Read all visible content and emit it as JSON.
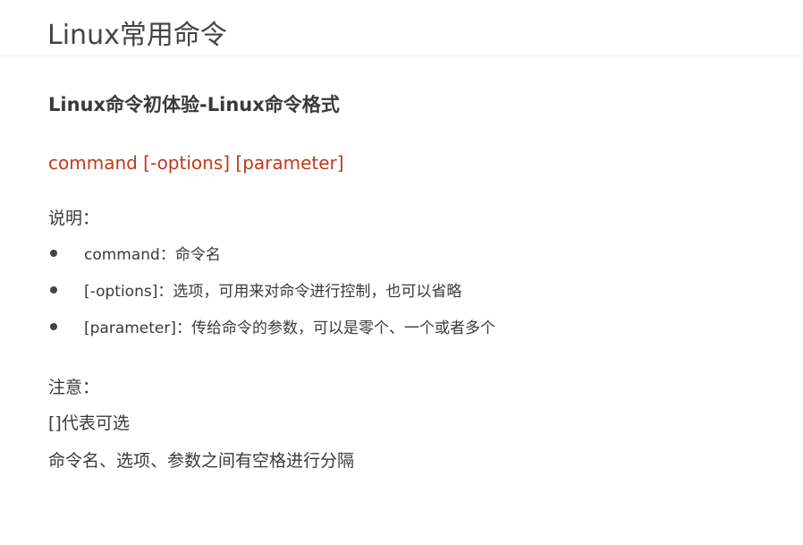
{
  "slide": {
    "title": "Linux常用命令",
    "subtitle": "Linux命令初体验-Linux命令格式",
    "syntax": "command [-options] [parameter]",
    "explanation": {
      "label": "说明：",
      "items": [
        "command：命令名",
        "[-options]：选项，可用来对命令进行控制，也可以省略",
        "[parameter]：传给命令的参数，可以是零个、一个或者多个"
      ]
    },
    "notes": {
      "label": "注意：",
      "lines": [
        "[]代表可选",
        "命令名、选项、参数之间有空格进行分隔"
      ]
    }
  },
  "colors": {
    "syntax_accent": "#c0391f",
    "text": "#3a3a3a"
  }
}
